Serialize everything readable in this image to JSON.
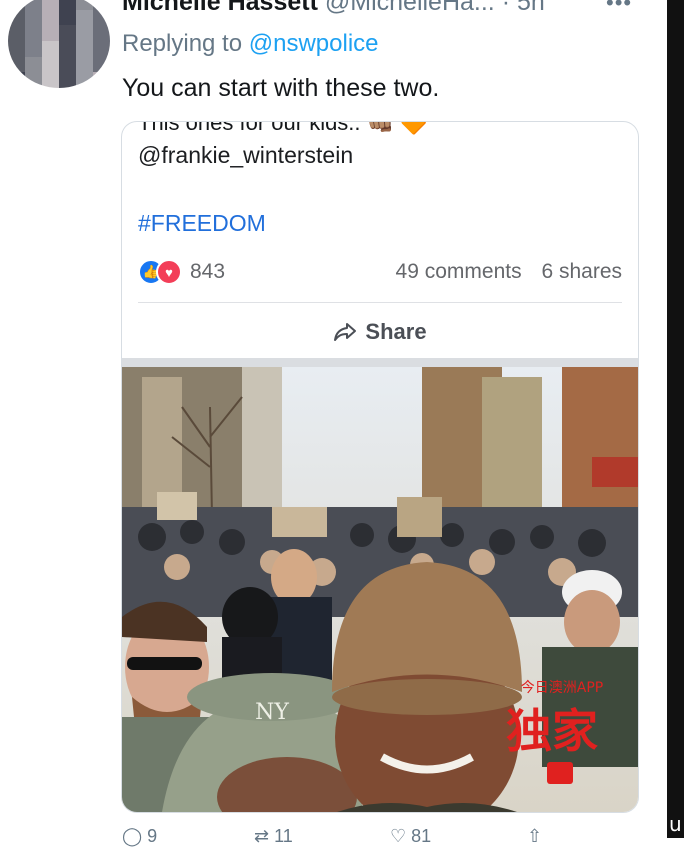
{
  "tweet": {
    "author_name": "Michelle Hassett",
    "author_handle": "@MichelleHa...",
    "time": "· 5h",
    "more_icon": "more-horizontal-icon",
    "replying_prefix": "Replying to",
    "replying_to": "@nswpolice",
    "text": "You can start with these two."
  },
  "card": {
    "cut_text": "This ones for our kids.. 👊🏽 🔶",
    "user_mention": "@frankie_winterstein",
    "hashtag": "#FREEDOM",
    "reaction_count": "843",
    "comments": "49 comments",
    "shares": "6 shares",
    "share_label": "Share",
    "reaction_icons": [
      "like-icon",
      "love-icon"
    ]
  },
  "watermark": {
    "top": "今日澳洲APP",
    "main": "独家"
  },
  "actions": [
    "reply-icon",
    "retweet-icon",
    "like-icon",
    "share-icon"
  ],
  "colors": {
    "link_blue": "#1da1f2",
    "fb_blue": "#216fdb",
    "gray_text": "#657786",
    "watermark_red": "#e0211f"
  }
}
